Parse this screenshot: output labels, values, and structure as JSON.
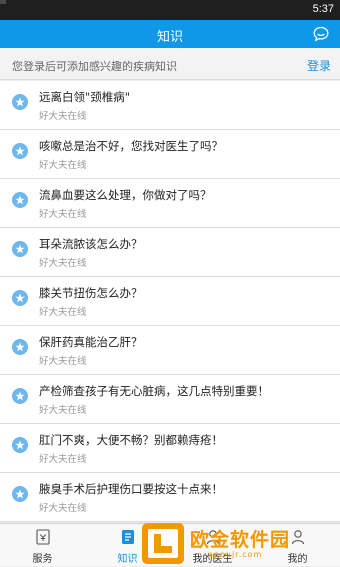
{
  "status_bar": {
    "time": "5:37"
  },
  "header": {
    "title": "知识",
    "chat_icon": "chat-bubble-icon"
  },
  "login_bar": {
    "hint": "您登录后可添加感兴趣的疾病知识",
    "login_label": "登录"
  },
  "articles": [
    {
      "title": "远离白领\"颈椎病\"",
      "source": "好大夫在线"
    },
    {
      "title": "咳嗽总是治不好，您找对医生了吗？",
      "source": "好大夫在线"
    },
    {
      "title": "流鼻血要这么处理，你做对了吗？",
      "source": "好大夫在线"
    },
    {
      "title": "耳朵流脓该怎么办？",
      "source": "好大夫在线"
    },
    {
      "title": "膝关节扭伤怎么办？",
      "source": "好大夫在线"
    },
    {
      "title": "保肝药真能治乙肝？",
      "source": "好大夫在线"
    },
    {
      "title": "产检筛查孩子有无心脏病，这几点特别重要！",
      "source": "好大夫在线"
    },
    {
      "title": "肛门不爽，大便不畅？别都赖痔疮！",
      "source": "好大夫在线"
    },
    {
      "title": "腋臭手术后护理伤口要按这十点来！",
      "source": "好大夫在线"
    }
  ],
  "tabs": [
    {
      "label": "服务",
      "icon": "service-icon"
    },
    {
      "label": "知识",
      "icon": "knowledge-icon",
      "active": true
    },
    {
      "label": "我的医生",
      "icon": "doctor-icon"
    },
    {
      "label": "我的",
      "icon": "profile-icon"
    }
  ],
  "watermark": {
    "text": "欧金软件园",
    "url": "apoujr.com"
  },
  "colors": {
    "primary": "#0f98e8",
    "accent_text": "#1a8fe0",
    "star_badge": "#6eb6ee",
    "watermark": "#f39800"
  }
}
